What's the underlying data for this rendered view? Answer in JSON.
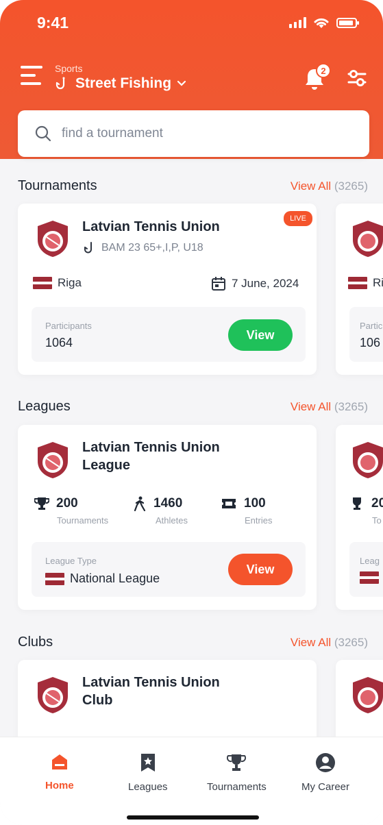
{
  "status_bar": {
    "time": "9:41"
  },
  "header": {
    "sport_label": "Sports",
    "sport_name": "Street Fishing",
    "notification_count": "2"
  },
  "search": {
    "placeholder": "find a tournament"
  },
  "tournaments": {
    "title": "Tournaments",
    "view_all": "View All",
    "count": "(3265)",
    "card": {
      "name": "Latvian Tennis Union",
      "categories": "BAM 23 65+,I,P, U18",
      "live": "LIVE",
      "city": "Riga",
      "date": "7 June, 2024",
      "participants_label": "Participants",
      "participants_value": "1064",
      "view_label": "View"
    },
    "peek": {
      "city": "Ri",
      "participants_label": "Partic",
      "participants_value": "106"
    }
  },
  "leagues": {
    "title": "Leagues",
    "view_all": "View All",
    "count": "(3265)",
    "card": {
      "name_line1": "Latvian Tennis Union",
      "name_line2": "League",
      "tournaments_value": "200",
      "tournaments_label": "Tournaments",
      "athletes_value": "1460",
      "athletes_label": "Athletes",
      "entries_value": "100",
      "entries_label": "Entries",
      "league_type_label": "League Type",
      "league_type_value": "National League",
      "view_label": "View"
    },
    "peek": {
      "stat_value": "20",
      "stat_label": "To",
      "type_label": "Leag"
    }
  },
  "clubs": {
    "title": "Clubs",
    "view_all": "View All",
    "count": "(3265)",
    "card": {
      "name_line1": "Latvian Tennis Union",
      "name_line2": "Club"
    }
  },
  "bottom_nav": [
    {
      "label": "Home",
      "icon": "home-icon",
      "active": true
    },
    {
      "label": "Leagues",
      "icon": "star-bookmark-icon",
      "active": false
    },
    {
      "label": "Tournaments",
      "icon": "trophy-icon",
      "active": false
    },
    {
      "label": "My Career",
      "icon": "user-icon",
      "active": false
    }
  ],
  "colors": {
    "accent": "#f4542c",
    "green": "#1fc15a",
    "text": "#1f2733"
  }
}
